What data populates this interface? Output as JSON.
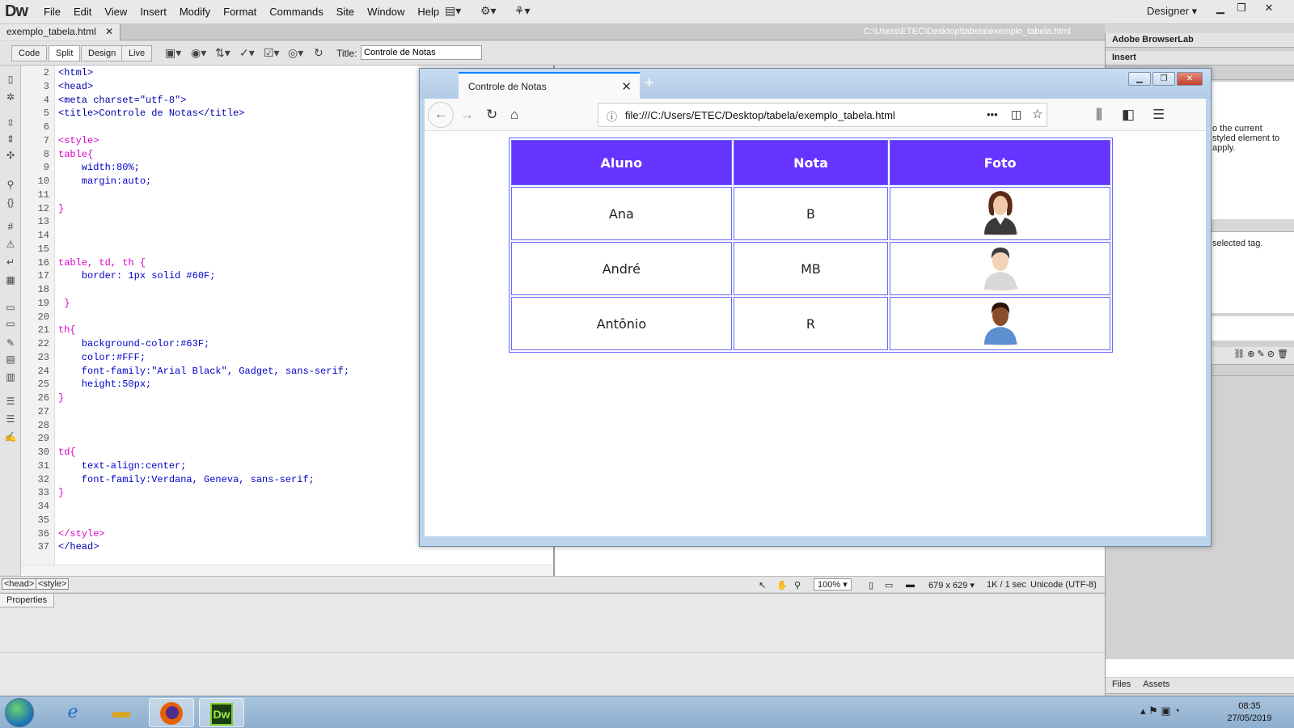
{
  "app": {
    "logo": "Dw",
    "menu": [
      "File",
      "Edit",
      "View",
      "Insert",
      "Modify",
      "Format",
      "Commands",
      "Site",
      "Window",
      "Help"
    ],
    "workspace": "Designer"
  },
  "document": {
    "tab_name": "exemplo_tabela.html",
    "path": "C:\\Users\\ETEC\\Desktop\\tabela\\exemplo_tabela.html",
    "views": [
      "Code",
      "Split",
      "Design",
      "Live"
    ],
    "active_view": "Split",
    "title_label": "Title:",
    "title_value": "Controle de Notas"
  },
  "code": {
    "lines": [
      {
        "n": "2",
        "text": "<html>",
        "kind": "tag"
      },
      {
        "n": "3",
        "text": "<head>",
        "kind": "tag"
      },
      {
        "n": "4",
        "text": "<meta charset=\"utf-8\">",
        "kind": "tag"
      },
      {
        "n": "5",
        "text": "<title>Controle de Notas</title>",
        "kind": "tag"
      },
      {
        "n": "6",
        "text": "",
        "kind": "tag"
      },
      {
        "n": "7",
        "text": "<style>",
        "kind": "sel"
      },
      {
        "n": "8",
        "text": "table{",
        "kind": "sel"
      },
      {
        "n": "9",
        "text": "    width:80%;",
        "kind": "prop"
      },
      {
        "n": "10",
        "text": "    margin:auto;",
        "kind": "prop"
      },
      {
        "n": "11",
        "text": "",
        "kind": "prop"
      },
      {
        "n": "12",
        "text": "}",
        "kind": "sel"
      },
      {
        "n": "13",
        "text": "",
        "kind": "prop"
      },
      {
        "n": "14",
        "text": "",
        "kind": "prop"
      },
      {
        "n": "15",
        "text": "",
        "kind": "prop"
      },
      {
        "n": "16",
        "text": "table, td, th {",
        "kind": "sel"
      },
      {
        "n": "17",
        "text": "    border: 1px solid #60F;",
        "kind": "prop"
      },
      {
        "n": "18",
        "text": "",
        "kind": "prop"
      },
      {
        "n": "19",
        "text": " }",
        "kind": "sel"
      },
      {
        "n": "20",
        "text": "",
        "kind": "prop"
      },
      {
        "n": "21",
        "text": "th{",
        "kind": "sel"
      },
      {
        "n": "22",
        "text": "    background-color:#63F;",
        "kind": "prop"
      },
      {
        "n": "23",
        "text": "    color:#FFF;",
        "kind": "prop"
      },
      {
        "n": "24",
        "text": "    font-family:\"Arial Black\", Gadget, sans-serif;",
        "kind": "prop"
      },
      {
        "n": "25",
        "text": "    height:50px;",
        "kind": "prop"
      },
      {
        "n": "26",
        "text": "}",
        "kind": "sel"
      },
      {
        "n": "27",
        "text": "",
        "kind": "prop"
      },
      {
        "n": "28",
        "text": "",
        "kind": "prop"
      },
      {
        "n": "29",
        "text": "",
        "kind": "prop"
      },
      {
        "n": "30",
        "text": "td{",
        "kind": "sel"
      },
      {
        "n": "31",
        "text": "    text-align:center;",
        "kind": "prop"
      },
      {
        "n": "32",
        "text": "    font-family:Verdana, Geneva, sans-serif;",
        "kind": "prop"
      },
      {
        "n": "33",
        "text": "}",
        "kind": "sel"
      },
      {
        "n": "34",
        "text": "",
        "kind": "prop"
      },
      {
        "n": "35",
        "text": "",
        "kind": "prop"
      },
      {
        "n": "36",
        "text": "</style>",
        "kind": "sel"
      },
      {
        "n": "37",
        "text": "</head>",
        "kind": "tag"
      }
    ]
  },
  "status": {
    "tags": [
      "<head>",
      "<style>"
    ],
    "zoom": "100%",
    "size": "679 x 629",
    "download": "1K / 1 sec",
    "encoding": "Unicode (UTF-8)"
  },
  "properties": {
    "tab": "Properties"
  },
  "right_panels": {
    "browserlab": "Adobe BrowserLab",
    "insert": "Insert",
    "css_hint": "o the current\nstyled element to\napply.",
    "tag_hint": "selected tag.",
    "files_tab": "Files",
    "assets_tab": "Assets"
  },
  "browser": {
    "tab_title": "Controle de Notas",
    "url": "file:///C:/Users/ETEC/Desktop/tabela/exemplo_tabela.html",
    "table": {
      "headers": [
        "Aluno",
        "Nota",
        "Foto"
      ],
      "rows": [
        {
          "aluno": "Ana",
          "nota": "B",
          "foto": "female-avatar-icon"
        },
        {
          "aluno": "André",
          "nota": "MB",
          "foto": "male-avatar-icon"
        },
        {
          "aluno": "Antônio",
          "nota": "R",
          "foto": "male-dark-avatar-icon"
        }
      ]
    }
  },
  "taskbar": {
    "apps": [
      "ie-icon",
      "explorer-icon",
      "firefox-icon",
      "dreamweaver-icon"
    ],
    "dw_label": "Dw",
    "time": "08:35",
    "date": "27/05/2019"
  },
  "colors": {
    "th_bg": "#63F",
    "border": "#60F"
  }
}
